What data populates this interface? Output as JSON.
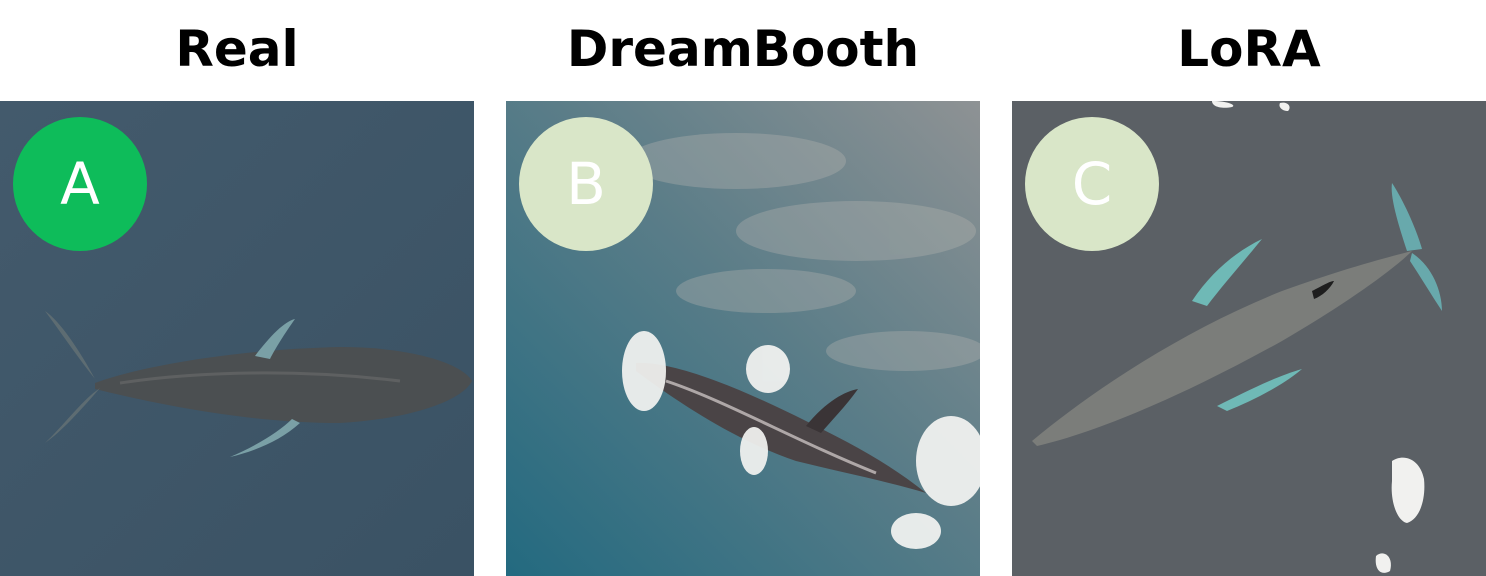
{
  "panels": [
    {
      "title": "Real",
      "badge": "A",
      "badge_color": "#0ebc5a",
      "scene": "real-whale-photo"
    },
    {
      "title": "DreamBooth",
      "badge": "B",
      "badge_color": "#d9e6c8",
      "scene": "dreambooth-generated-whale"
    },
    {
      "title": "LoRA",
      "badge": "C",
      "badge_color": "#d9e6c8",
      "scene": "lora-generated-whale"
    }
  ],
  "colors": {
    "water_real": "#3e5668",
    "water_dreambooth": "#2f6b80",
    "water_lora": "#5a5f64"
  }
}
